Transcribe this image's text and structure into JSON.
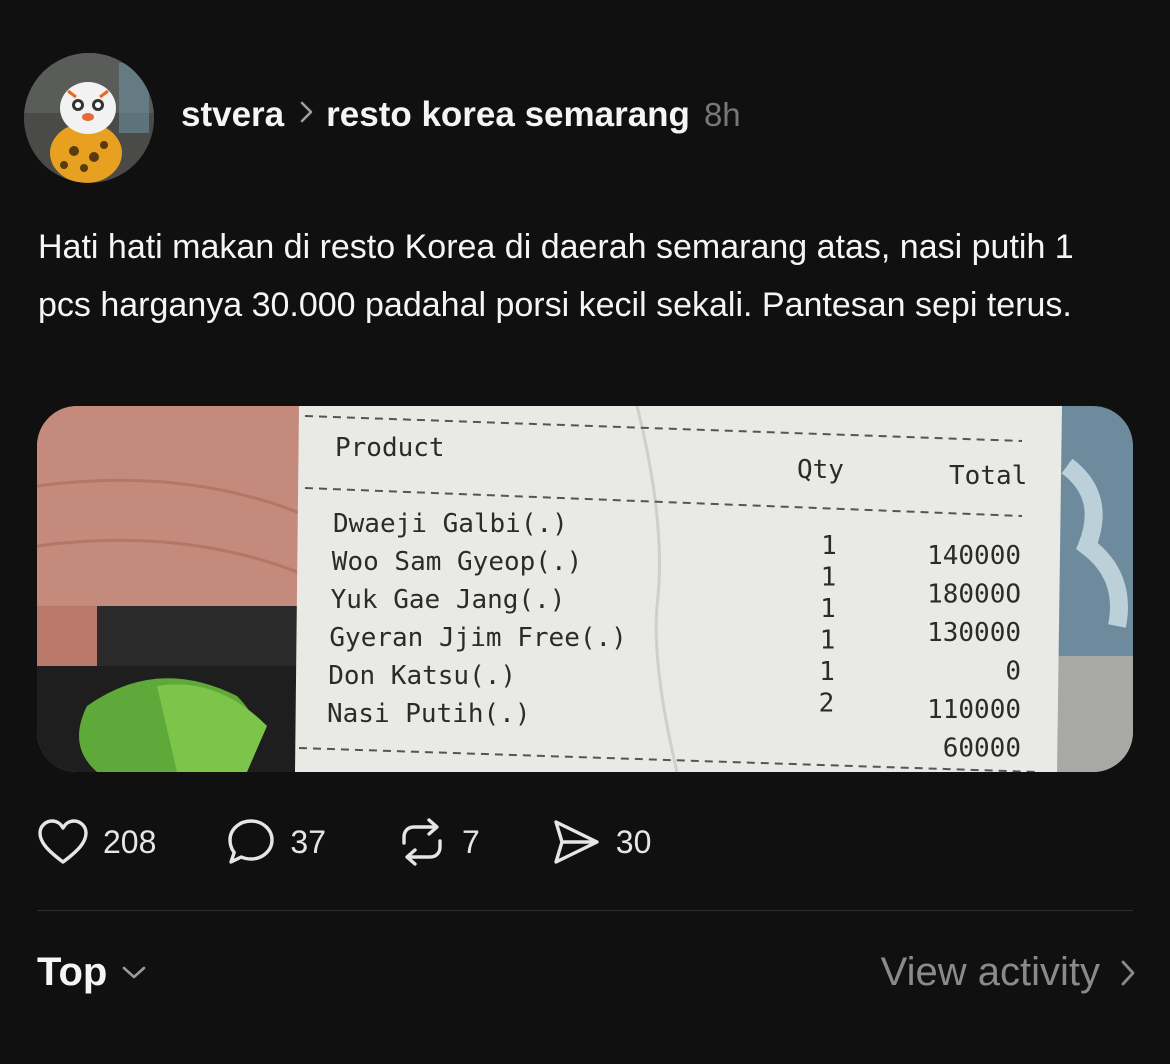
{
  "post": {
    "username": "stvera",
    "community": "resto korea semarang",
    "timestamp": "8h",
    "text": "Hati hati makan di resto Korea di daerah semarang atas, nasi putih 1 pcs harganya 30.000 padahal porsi kecil sekali. Pantesan sepi terus.",
    "image": {
      "receipt": {
        "headers": {
          "product": "Product",
          "qty": "Qty",
          "total": "Total"
        },
        "products": [
          "Dwaeji Galbi(.)",
          "Woo Sam Gyeop(.)",
          "Yuk Gae Jang(.)",
          "Gyeran Jjim Free(.)",
          "Don Katsu(.)",
          "Nasi Putih(.)"
        ],
        "qtys": [
          "1",
          "1",
          "1",
          "1",
          "1",
          "2"
        ],
        "totals": [
          "140000",
          "18000O",
          "130000",
          "0",
          "110000",
          "60000"
        ]
      }
    },
    "actions": {
      "likes": "208",
      "replies": "37",
      "reposts": "7",
      "shares": "30"
    }
  },
  "footer": {
    "sort_label": "Top",
    "view_activity_label": "View activity"
  },
  "colors": {
    "background": "#101010",
    "text_primary": "#f3f5f7",
    "text_secondary": "#777777",
    "icon": "chevron-right-icon"
  }
}
